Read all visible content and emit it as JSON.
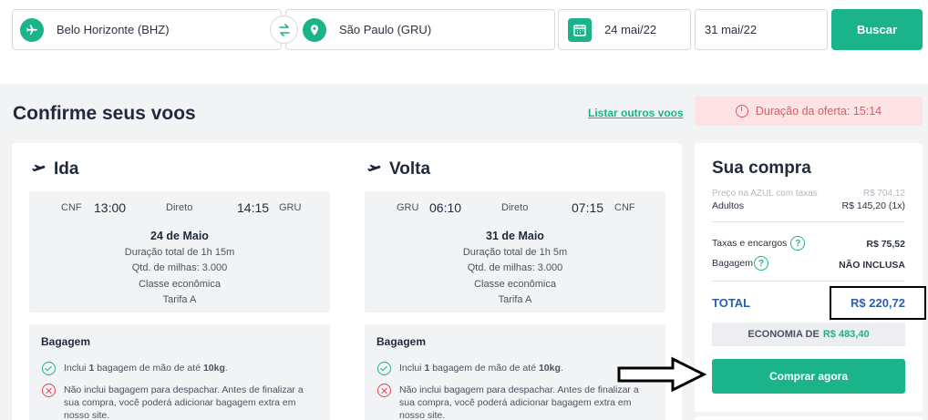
{
  "search": {
    "origin": "Belo Horizonte (BHZ)",
    "destination": "São Paulo (GRU)",
    "depart_date": "24 mai/22",
    "return_date": "31 mai/22",
    "search_label": "Buscar"
  },
  "page": {
    "title": "Confirme seus voos",
    "list_other": "Listar outros voos",
    "timer": "Duração da oferta: 15:14"
  },
  "outbound": {
    "title": "Ida",
    "from": "CNF",
    "depart_time": "13:00",
    "type": "Direto",
    "arrive_time": "14:15",
    "to": "GRU",
    "date": "24 de Maio",
    "duration": "Duração total de 1h 15m",
    "miles": "Qtd. de milhas: 3.000",
    "cabin": "Classe econômica",
    "fare": "Tarifa A",
    "baggage_title": "Bagagem",
    "bag_included_pre": "Inclui ",
    "bag_included_count": "1",
    "bag_included_mid": " bagagem de mão de até ",
    "bag_included_weight": "10kg",
    "bag_included_post": ".",
    "bag_excluded": "Não inclui bagagem para despachar. Antes de finalizar a sua compra, você poderá adicionar bagagem extra em nosso site."
  },
  "inbound": {
    "title": "Volta",
    "from": "GRU",
    "depart_time": "06:10",
    "type": "Direto",
    "arrive_time": "07:15",
    "to": "CNF",
    "date": "31 de Maio",
    "duration": "Duração total de 1h 5m",
    "miles": "Qtd. de milhas: 3.000",
    "cabin": "Classe econômica",
    "fare": "Tarifa A",
    "baggage_title": "Bagagem",
    "bag_included_pre": "Inclui ",
    "bag_included_count": "1",
    "bag_included_mid": " bagagem de mão de até ",
    "bag_included_weight": "10kg",
    "bag_included_post": ".",
    "bag_excluded": "Não inclui bagagem para despachar. Antes de finalizar a sua compra, você poderá adicionar bagagem extra em nosso site."
  },
  "summary": {
    "title": "Sua compra",
    "azul_label": "Preço na AZUL com taxas",
    "azul_value": "R$ 704,12",
    "adults_label": "Adultos",
    "adults_value": "R$ 145,20 (1x)",
    "taxes_label": "Taxas e encargos",
    "taxes_value": "R$ 75,52",
    "baggage_label": "Bagagem",
    "baggage_value": "NÃO INCLUSA",
    "total_label": "TOTAL",
    "total_value": "R$ 220,72",
    "economy_label": "ECONOMIA DE",
    "economy_value": "R$ 483,40",
    "buy_label": "Comprar agora"
  },
  "colors": {
    "accent": "#1bb38a",
    "total": "#2a5fb0",
    "timer_bg": "#fde3e4",
    "timer_text": "#e25a5f"
  }
}
